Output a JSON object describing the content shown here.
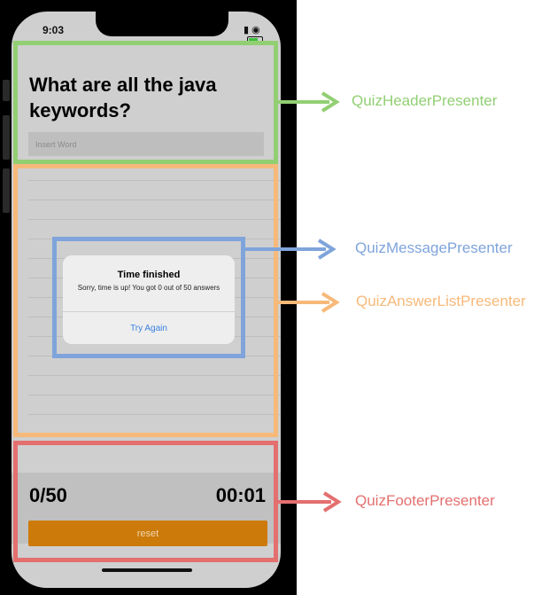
{
  "colors": {
    "header": "#92cf73",
    "list": "#f7b979",
    "message": "#7fa4db",
    "footer": "#e46f6f"
  },
  "status_bar": {
    "time": "9:03",
    "signal_icon": "signal-icon",
    "wifi_icon": "wifi-icon",
    "battery_icon": "battery-icon"
  },
  "quiz": {
    "question": "What are all the java keywords?",
    "input_placeholder": "Insert Word",
    "score": "0/50",
    "timer": "00:01",
    "reset_label": "reset"
  },
  "alert": {
    "title": "Time finished",
    "message": "Sorry, time is up! You got 0 out of 50 answers",
    "action": "Try Again"
  },
  "labels": {
    "header": "QuizHeaderPresenter",
    "message": "QuizMessagePresenter",
    "list": "QuizAnswerListPresenter",
    "footer": "QuizFooterPresenter"
  }
}
